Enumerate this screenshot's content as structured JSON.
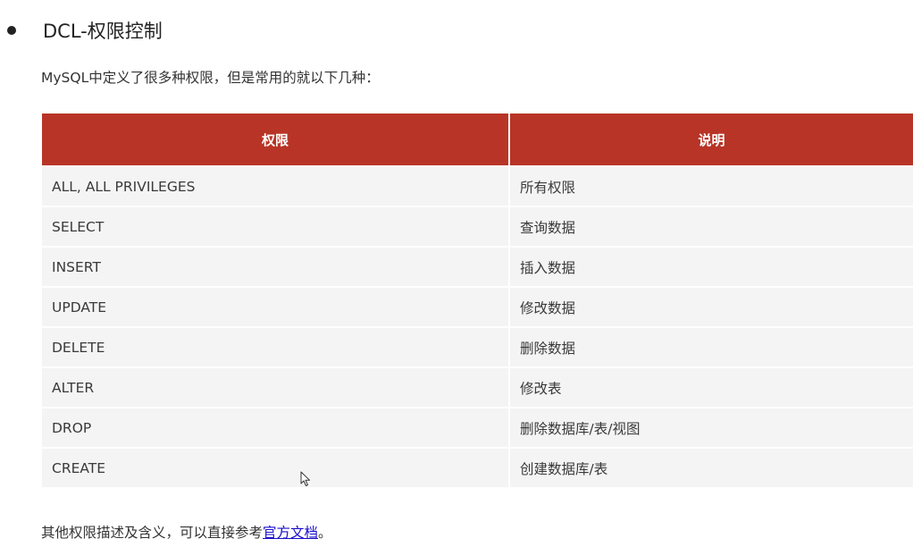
{
  "heading": {
    "title": "DCL-权限控制"
  },
  "intro": {
    "text": "MySQL中定义了很多种权限，但是常用的就以下几种："
  },
  "table": {
    "headers": [
      "权限",
      "说明"
    ],
    "rows": [
      [
        "ALL, ALL PRIVILEGES",
        "所有权限"
      ],
      [
        "SELECT",
        "查询数据"
      ],
      [
        "INSERT",
        "插入数据"
      ],
      [
        "UPDATE",
        "修改数据"
      ],
      [
        "DELETE",
        "删除数据"
      ],
      [
        "ALTER",
        "修改表"
      ],
      [
        "DROP",
        "删除数据库/表/视图"
      ],
      [
        "CREATE",
        "创建数据库/表"
      ]
    ]
  },
  "footer": {
    "text_before": "其他权限描述及含义，可以直接参考",
    "link_text": "官方文档",
    "text_after": "。"
  },
  "colors": {
    "header_bg": "#b83426",
    "row_bg": "#f4f4f4",
    "link": "#1a0dcc"
  },
  "icons": {
    "bullet": "bullet-dot-icon",
    "cursor": "mouse-pointer-icon"
  }
}
